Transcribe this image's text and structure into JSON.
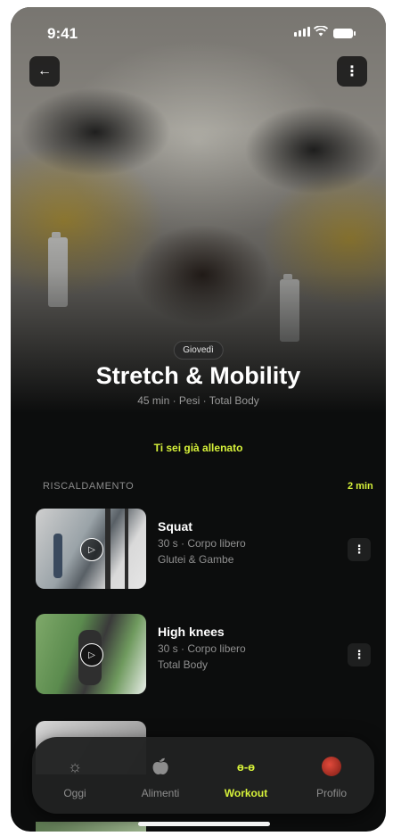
{
  "status_bar": {
    "time": "9:41"
  },
  "header": {
    "back_icon": "←",
    "more_icon": "⋮"
  },
  "hero": {
    "day": "Giovedì",
    "title": "Stretch & Mobility",
    "subtitle": "45 min · Pesi · Total Body"
  },
  "trained_notice": "Ti sei già allenato",
  "section": {
    "label": "RISCALDAMENTO",
    "duration": "2 min"
  },
  "exercises": [
    {
      "name": "Squat",
      "meta": "30 s · Corpo libero",
      "target": "Glutei & Gambe"
    },
    {
      "name": "High knees",
      "meta": "30 s · Corpo libero",
      "target": "Total Body"
    }
  ],
  "icons": {
    "play": "▷",
    "more": "⋮",
    "today": "☼",
    "food": "🍎︎",
    "workout": "ɵ-ɵ"
  },
  "tabbar": {
    "items": [
      {
        "label": "Oggi",
        "icon": "sun-icon"
      },
      {
        "label": "Alimenti",
        "icon": "apple-icon"
      },
      {
        "label": "Workout",
        "icon": "dumbbell-icon",
        "active": true
      },
      {
        "label": "Profilo",
        "icon": "avatar"
      }
    ]
  },
  "colors": {
    "accent": "#d7f23a",
    "background": "#0c0d0d"
  }
}
